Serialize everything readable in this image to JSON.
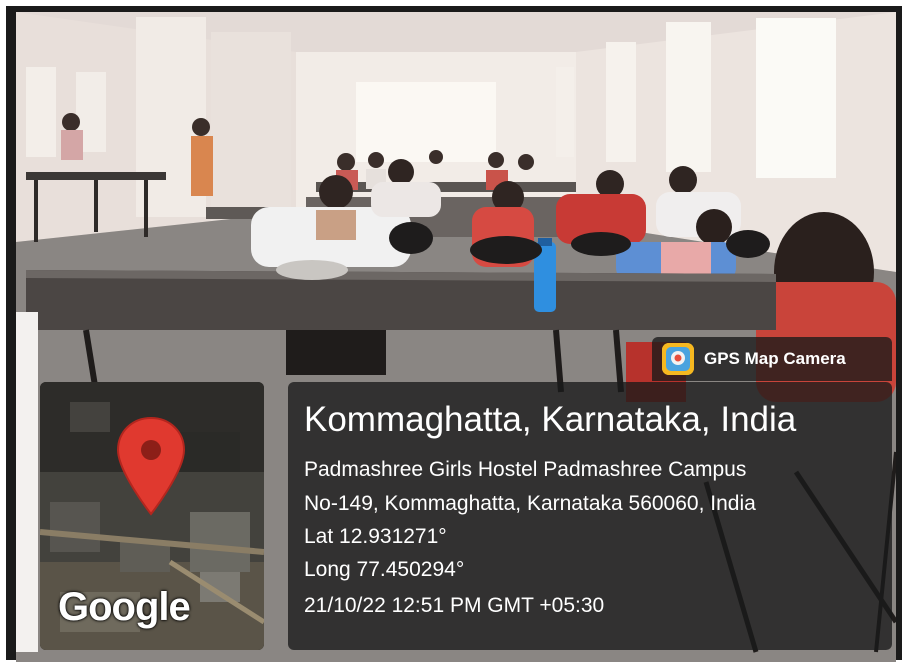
{
  "overlay": {
    "app_badge": {
      "icon": "gps-map-camera-icon",
      "label": "GPS Map Camera"
    },
    "location": {
      "title": "Kommaghatta, Karnataka, India",
      "address_line1": "Padmashree Girls Hostel Padmashree Campus",
      "address_line2": "No-149, Kommaghatta, Karnataka 560060, India",
      "latitude": "Lat 12.931271°",
      "longitude": "Long 77.450294°",
      "datetime": "21/10/22 12:51 PM GMT +05:30"
    },
    "map": {
      "brand": "Google",
      "pin_icon": "map-pin-icon",
      "pin_color": "#e0392f"
    }
  }
}
